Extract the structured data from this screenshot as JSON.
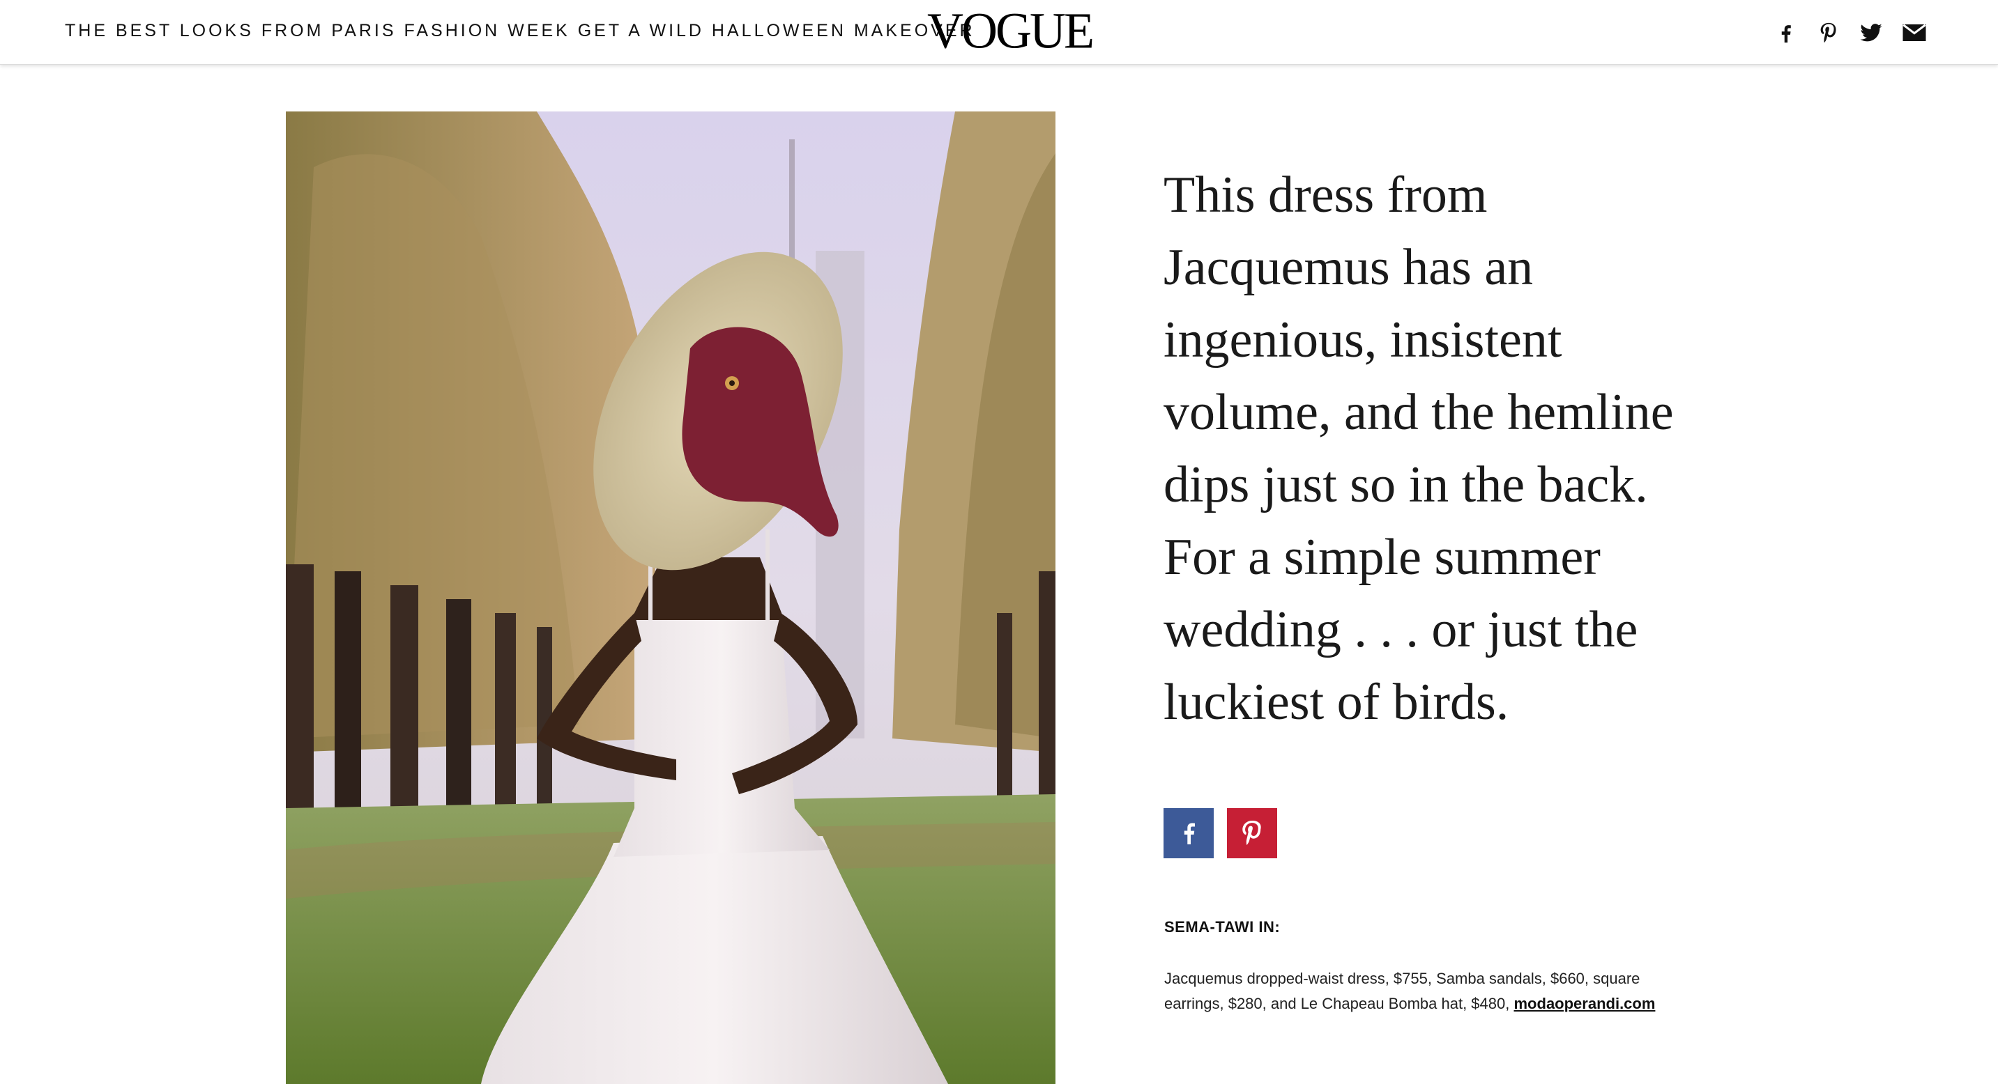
{
  "header": {
    "title": "THE BEST LOOKS FROM PARIS FASHION WEEK GET A WILD HALLOWEEN MAKEOVER",
    "logo": "VOGUE",
    "social_icons": [
      "facebook-icon",
      "pinterest-icon",
      "twitter-icon",
      "mail-icon"
    ]
  },
  "photo": {
    "description_icon": "photo"
  },
  "caption": {
    "text": "This dress from Jacquemus has an ingenious, insistent volume, and the hemline dips just so in the back. For a simple summer wedding . . . or just the luckiest of birds."
  },
  "share_buttons": {
    "facebook_color": "#3d5a98",
    "pinterest_color": "#c61f35"
  },
  "credits": {
    "heading": "SEMA-TAWI IN:",
    "text": "Jacquemus dropped-waist dress, $755, Samba sandals, $660, square earrings, $280, and Le Chapeau Bomba hat, $480,",
    "link": "modaoperandi.com"
  }
}
